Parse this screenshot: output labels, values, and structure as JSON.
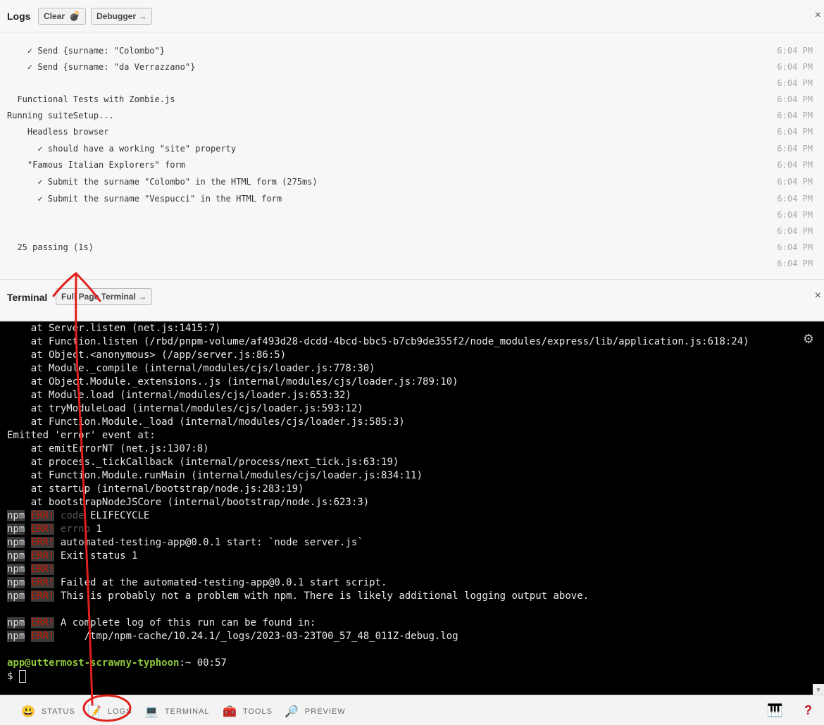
{
  "logs": {
    "title": "Logs",
    "clear_label": "Clear",
    "clear_icon": "bomb-icon",
    "debugger_label": "Debugger →",
    "close": "×",
    "rows": [
      {
        "text": "    ✓ Send {surname: \"Colombo\"}",
        "time": "6:04 PM"
      },
      {
        "text": "    ✓ Send {surname: \"da Verrazzano\"}",
        "time": "6:04 PM"
      },
      {
        "text": "",
        "time": "6:04 PM"
      },
      {
        "text": "  Functional Tests with Zombie.js",
        "time": "6:04 PM"
      },
      {
        "text": "Running suiteSetup...",
        "time": "6:04 PM"
      },
      {
        "text": "    Headless browser",
        "time": "6:04 PM"
      },
      {
        "text": "      ✓ should have a working \"site\" property",
        "time": "6:04 PM"
      },
      {
        "text": "    \"Famous Italian Explorers\" form",
        "time": "6:04 PM"
      },
      {
        "text": "      ✓ Submit the surname \"Colombo\" in the HTML form (275ms)",
        "time": "6:04 PM"
      },
      {
        "text": "      ✓ Submit the surname \"Vespucci\" in the HTML form",
        "time": "6:04 PM"
      },
      {
        "text": "",
        "time": "6:04 PM"
      },
      {
        "text": "",
        "time": "6:04 PM"
      },
      {
        "text": "  25 passing (1s)",
        "time": "6:04 PM"
      },
      {
        "text": "",
        "time": "6:04 PM"
      }
    ]
  },
  "terminal": {
    "title": "Terminal",
    "full_page_label": "Full Page Terminal →",
    "close": "×",
    "lines": [
      "    at Server.listen (net.js:1415:7)",
      "    at Function.listen (/rbd/pnpm-volume/af493d28-dcdd-4bcd-bbc5-b7cb9de355f2/node_modules/express/lib/application.js:618:24)",
      "    at Object.<anonymous> (/app/server.js:86:5)",
      "    at Module._compile (internal/modules/cjs/loader.js:778:30)",
      "    at Object.Module._extensions..js (internal/modules/cjs/loader.js:789:10)",
      "    at Module.load (internal/modules/cjs/loader.js:653:32)",
      "    at tryModuleLoad (internal/modules/cjs/loader.js:593:12)",
      "    at Function.Module._load (internal/modules/cjs/loader.js:585:3)",
      "Emitted 'error' event at:",
      "    at emitErrorNT (net.js:1307:8)",
      "    at process._tickCallback (internal/process/next_tick.js:63:19)",
      "    at Function.Module.runMain (internal/modules/cjs/loader.js:834:11)",
      "    at startup (internal/bootstrap/node.js:283:19)",
      "    at bootstrapNodeJSCore (internal/bootstrap/node.js:623:3)"
    ],
    "npm_label": "npm",
    "err_label": "ERR!",
    "npm_lines": [
      {
        "dim": "code",
        "text": " ELIFECYCLE"
      },
      {
        "dim": "errno",
        "text": " 1"
      },
      {
        "dim": "",
        "text": "automated-testing-app@0.0.1 start: `node server.js`"
      },
      {
        "dim": "",
        "text": "Exit status 1"
      },
      {
        "dim": "",
        "text": ""
      },
      {
        "dim": "",
        "text": "Failed at the automated-testing-app@0.0.1 start script."
      },
      {
        "dim": "",
        "text": "This is probably not a problem with npm. There is likely additional logging output above."
      }
    ],
    "npm_lines2": [
      {
        "dim": "",
        "text": "A complete log of this run can be found in:"
      },
      {
        "dim": "",
        "text": "    /tmp/npm-cache/10.24.1/_logs/2023-03-23T00_57_48_011Z-debug.log"
      }
    ],
    "prompt_user": "app@uttermost-scrawny-typhoon",
    "prompt_rest": ":~ 00:57",
    "prompt_symbol": "$ "
  },
  "footer": {
    "tabs": [
      {
        "label": "STATUS",
        "icon": "smiley-icon"
      },
      {
        "label": "LOGS",
        "icon": "memo-icon"
      },
      {
        "label": "TERMINAL",
        "icon": "laptop-icon"
      },
      {
        "label": "TOOLS",
        "icon": "toolbox-icon"
      },
      {
        "label": "PREVIEW",
        "icon": "magnifier-icon"
      }
    ]
  },
  "annotation": {
    "color": "#e0201c"
  }
}
